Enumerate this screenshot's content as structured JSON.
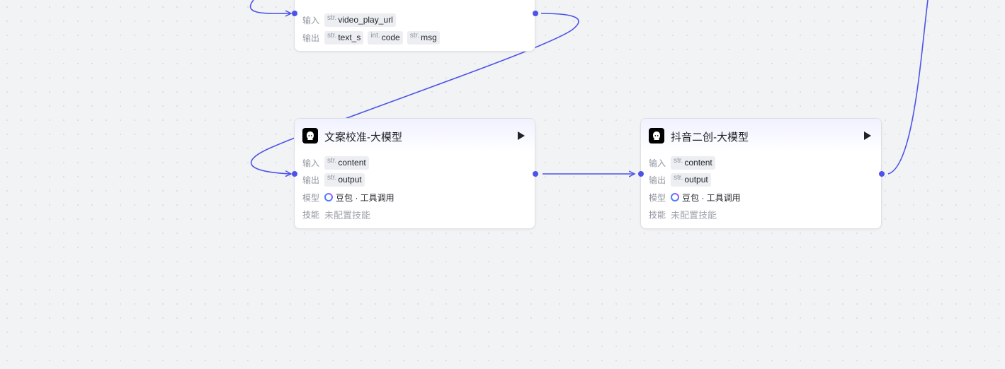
{
  "colors": {
    "edge": "#4d53e8",
    "canvas": "#f2f3f5"
  },
  "node_top": {
    "input_label": "输入",
    "output_label": "输出",
    "inputs": [
      {
        "type": "str.",
        "name": "video_play_url"
      }
    ],
    "outputs": [
      {
        "type": "str.",
        "name": "text_s"
      },
      {
        "type": "int.",
        "name": "code"
      },
      {
        "type": "str.",
        "name": "msg"
      }
    ]
  },
  "node_proofread": {
    "title": "文案校准-大模型",
    "icon": "llm-icon",
    "input_label": "输入",
    "output_label": "输出",
    "model_label": "模型",
    "skills_label": "技能",
    "inputs": [
      {
        "type": "str.",
        "name": "content"
      }
    ],
    "outputs": [
      {
        "type": "str.",
        "name": "output"
      }
    ],
    "model": "豆包 · 工具调用",
    "skills": "未配置技能"
  },
  "node_douyin": {
    "title": "抖音二创-大模型",
    "icon": "llm-icon",
    "input_label": "输入",
    "output_label": "输出",
    "model_label": "模型",
    "skills_label": "技能",
    "inputs": [
      {
        "type": "str.",
        "name": "content"
      }
    ],
    "outputs": [
      {
        "type": "str.",
        "name": "output"
      }
    ],
    "model": "豆包 · 工具调用",
    "skills": "未配置技能"
  }
}
